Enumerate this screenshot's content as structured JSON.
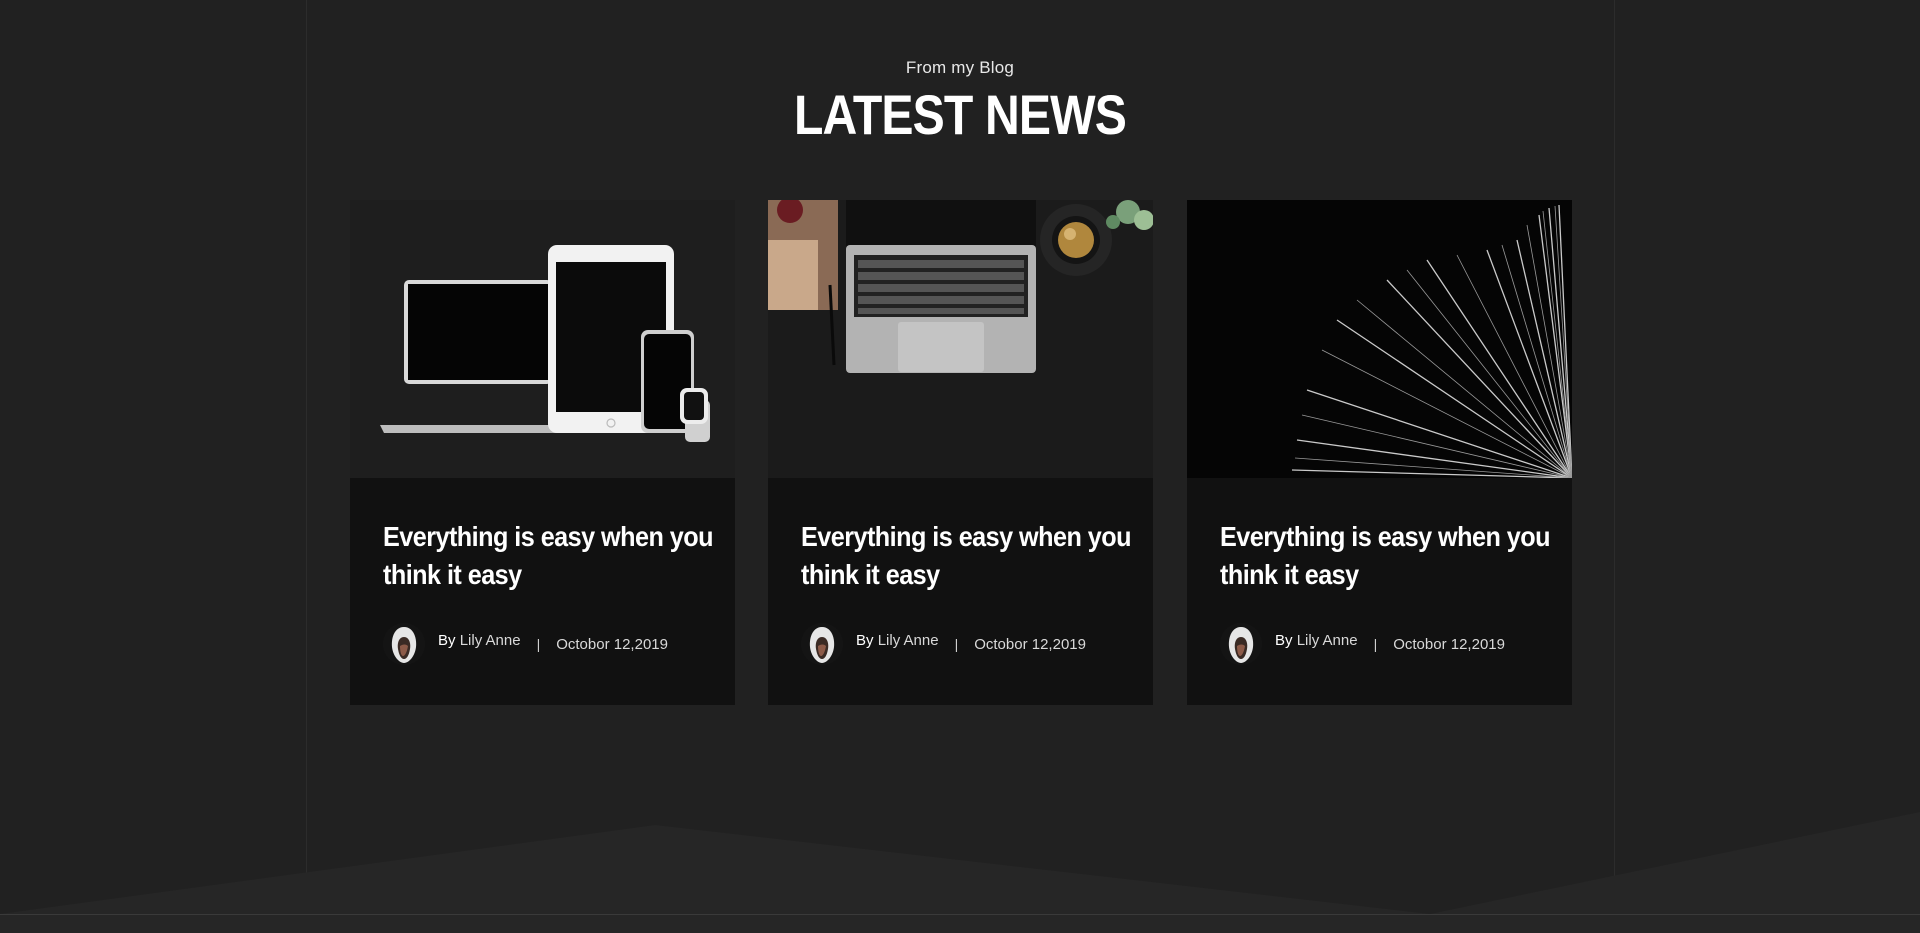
{
  "section": {
    "subtitle": "From my Blog",
    "title": "LATEST NEWS"
  },
  "posts": [
    {
      "image": "devices-mockup-image",
      "title": "Everything is easy when you think it easy",
      "by_label": "By",
      "author": "Lily Anne",
      "separator": "|",
      "date": "Octobor 12,2019"
    },
    {
      "image": "laptop-desk-image",
      "title": "Everything is easy when you think it easy",
      "by_label": "By",
      "author": "Lily Anne",
      "separator": "|",
      "date": "Octobor 12,2019"
    },
    {
      "image": "open-book-image",
      "title": "Everything is easy when you think it easy",
      "by_label": "By",
      "author": "Lily Anne",
      "separator": "|",
      "date": "Octobor 12,2019"
    }
  ],
  "colors": {
    "background": "#212121",
    "card": "#111111",
    "text": "#ffffff"
  }
}
